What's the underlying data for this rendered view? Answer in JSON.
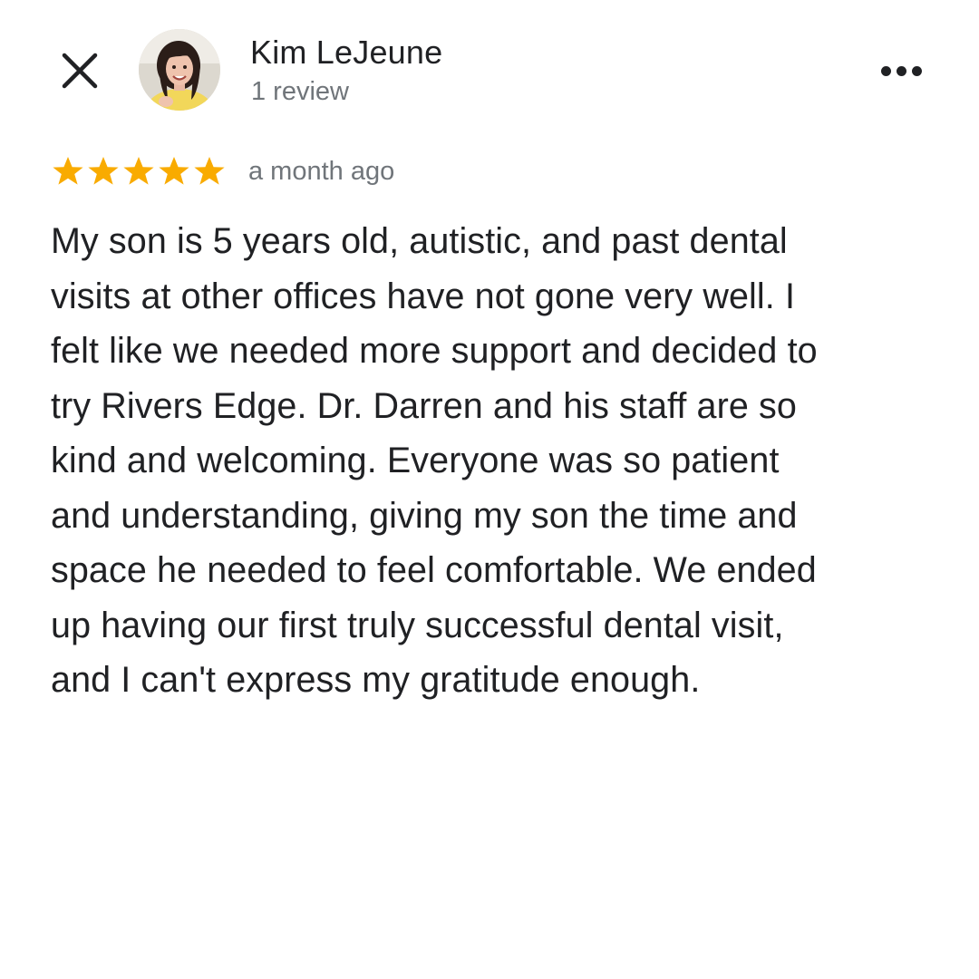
{
  "review_dialog": {
    "close_icon": "close-icon",
    "more_icon": "more-horizontal-icon",
    "reviewer": {
      "name": "Kim LeJeune",
      "review_count": "1 review",
      "avatar": "avatar-photo"
    },
    "rating": {
      "stars": 5,
      "max_stars": 5,
      "star_color": "#F9AB00",
      "date": "a month ago"
    },
    "review_text_lines": [
      "My son is 5 years old, autistic, and past dental",
      "visits at other offices have not gone very well. I",
      "felt like we needed more support and decided to",
      "try Rivers Edge. Dr. Darren and his staff are so",
      "kind and welcoming. Everyone was so patient",
      "and understanding, giving my son the time and",
      "space he needed to feel comfortable. We ended",
      "up having our first truly successful dental visit,",
      "and I can't express my gratitude enough."
    ]
  }
}
